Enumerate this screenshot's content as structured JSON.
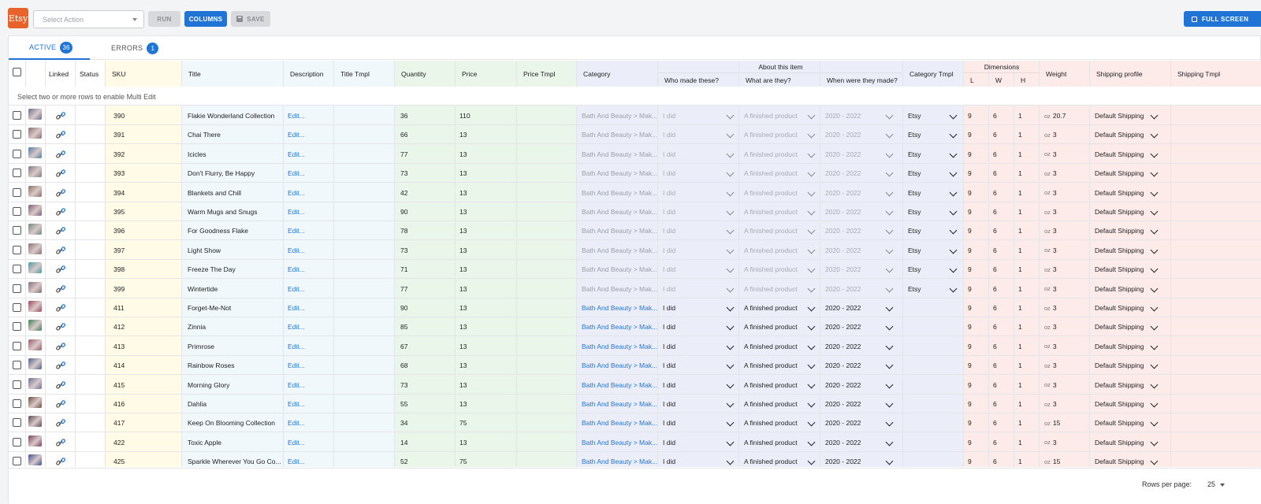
{
  "toolbar": {
    "logo": "Etsy",
    "select_action_placeholder": "Select Action",
    "run_label": "RUN",
    "columns_label": "COLUMNS",
    "save_label": "SAVE",
    "full_screen_label": "FULL SCREEN"
  },
  "tabs": [
    {
      "label": "ACTIVE",
      "count": "36"
    },
    {
      "label": "ERRORS",
      "count": "1"
    }
  ],
  "colors": {
    "accent": "#1f74d6",
    "sku_bg": "#fffbe6",
    "qty_bg": "#eaf6ea",
    "cat_bg": "#ebeef9",
    "dim_bg": "#fdebea",
    "title_bg": "#f0f8fb"
  },
  "table": {
    "headers": {
      "linked": "Linked",
      "status": "Status",
      "sku": "SKU",
      "title": "Title",
      "description": "Description",
      "title_tmpl": "Title Tmpl",
      "quantity": "Quantity",
      "price": "Price",
      "price_tmpl": "Price Tmpl",
      "category": "Category",
      "about": "About this item",
      "who": "Who made these?",
      "what": "What are they?",
      "when": "When were they made?",
      "category_tmpl": "Category Tmpl",
      "dimensions": "Dimensions",
      "l": "L",
      "w": "W",
      "h": "H",
      "weight": "Weight",
      "shipping_profile": "Shipping profile",
      "shipping_tmpl": "Shipping Tmpl"
    },
    "multi_edit_hint": "Select two or more rows to enable Multi Edit",
    "edit_label": "Edit...",
    "category_text": "Bath And Beauty > Mak...",
    "who_value": "I did",
    "what_value": "A finished product",
    "when_value": "2020 - 2022",
    "category_tmpl_value": "Etsy",
    "weight_unit": "oz",
    "shipping_value": "Default Shipping",
    "rows": [
      {
        "sku": "390",
        "title": "Flakie Wonderland Collection",
        "qty": "36",
        "price": "110",
        "l": "9",
        "w": "6",
        "h": "1",
        "weight": "20.7",
        "tmpl": true,
        "thumb": "#6b6f8a"
      },
      {
        "sku": "391",
        "title": "Chai There",
        "qty": "66",
        "price": "13",
        "l": "9",
        "w": "6",
        "h": "1",
        "weight": "3",
        "tmpl": true,
        "thumb": "#8a6e70"
      },
      {
        "sku": "392",
        "title": "Icicles",
        "qty": "77",
        "price": "13",
        "l": "9",
        "w": "6",
        "h": "1",
        "weight": "3",
        "tmpl": true,
        "thumb": "#4f7fa6"
      },
      {
        "sku": "393",
        "title": "Don't Flurry, Be Happy",
        "qty": "73",
        "price": "13",
        "l": "9",
        "w": "6",
        "h": "1",
        "weight": "3",
        "tmpl": true,
        "thumb": "#7d7a86"
      },
      {
        "sku": "394",
        "title": "Blankets  and  Chill",
        "qty": "42",
        "price": "13",
        "l": "9",
        "w": "6",
        "h": "1",
        "weight": "3",
        "tmpl": true,
        "thumb": "#8a7265"
      },
      {
        "sku": "395",
        "title": "Warm Mugs  and  Snugs",
        "qty": "90",
        "price": "13",
        "l": "9",
        "w": "6",
        "h": "1",
        "weight": "3",
        "tmpl": true,
        "thumb": "#7a5f74"
      },
      {
        "sku": "396",
        "title": "For Goodness Flake",
        "qty": "78",
        "price": "13",
        "l": "9",
        "w": "6",
        "h": "1",
        "weight": "3",
        "tmpl": true,
        "thumb": "#6f8a7e"
      },
      {
        "sku": "397",
        "title": "Light Show",
        "qty": "73",
        "price": "13",
        "l": "9",
        "w": "6",
        "h": "1",
        "weight": "3",
        "tmpl": true,
        "thumb": "#8b6f7a"
      },
      {
        "sku": "398",
        "title": "Freeze The Day",
        "qty": "71",
        "price": "13",
        "l": "9",
        "w": "6",
        "h": "1",
        "weight": "3",
        "tmpl": true,
        "thumb": "#4a9aa6"
      },
      {
        "sku": "399",
        "title": "Wintertide",
        "qty": "77",
        "price": "13",
        "l": "9",
        "w": "6",
        "h": "1",
        "weight": "3",
        "tmpl": true,
        "thumb": "#80707c"
      },
      {
        "sku": "411",
        "title": "Forget-Me-Not",
        "qty": "90",
        "price": "13",
        "l": "9",
        "w": "6",
        "h": "1",
        "weight": "3",
        "tmpl": false,
        "thumb": "#a0455e"
      },
      {
        "sku": "412",
        "title": "Zinnia",
        "qty": "85",
        "price": "13",
        "l": "9",
        "w": "6",
        "h": "1",
        "weight": "3",
        "tmpl": false,
        "thumb": "#3f7f52"
      },
      {
        "sku": "413",
        "title": "Primrose",
        "qty": "67",
        "price": "13",
        "l": "9",
        "w": "6",
        "h": "1",
        "weight": "3",
        "tmpl": false,
        "thumb": "#9b5a6a"
      },
      {
        "sku": "414",
        "title": "Rainbow Roses",
        "qty": "68",
        "price": "13",
        "l": "9",
        "w": "6",
        "h": "1",
        "weight": "3",
        "tmpl": false,
        "thumb": "#4c5f8f"
      },
      {
        "sku": "415",
        "title": "Morning Glory",
        "qty": "73",
        "price": "13",
        "l": "9",
        "w": "6",
        "h": "1",
        "weight": "3",
        "tmpl": false,
        "thumb": "#6b6f96"
      },
      {
        "sku": "416",
        "title": "Dahlia",
        "qty": "55",
        "price": "13",
        "l": "9",
        "w": "6",
        "h": "1",
        "weight": "3",
        "tmpl": false,
        "thumb": "#6e4f3f"
      },
      {
        "sku": "417",
        "title": "Keep On Blooming Collection",
        "qty": "34",
        "price": "75",
        "l": "9",
        "w": "6",
        "h": "1",
        "weight": "15",
        "tmpl": false,
        "thumb": "#5a4a55"
      },
      {
        "sku": "422",
        "title": "Toxic Apple",
        "qty": "14",
        "price": "13",
        "l": "9",
        "w": "6",
        "h": "1",
        "weight": "3",
        "tmpl": false,
        "thumb": "#7a3f5a"
      },
      {
        "sku": "425",
        "title": "Sparkle Wherever You Go Co...",
        "qty": "52",
        "price": "75",
        "l": "9",
        "w": "6",
        "h": "1",
        "weight": "15",
        "tmpl": false,
        "thumb": "#3f4f8f"
      }
    ]
  },
  "footer": {
    "rows_per_page_label": "Rows per page:",
    "rows_per_page_value": "25"
  }
}
